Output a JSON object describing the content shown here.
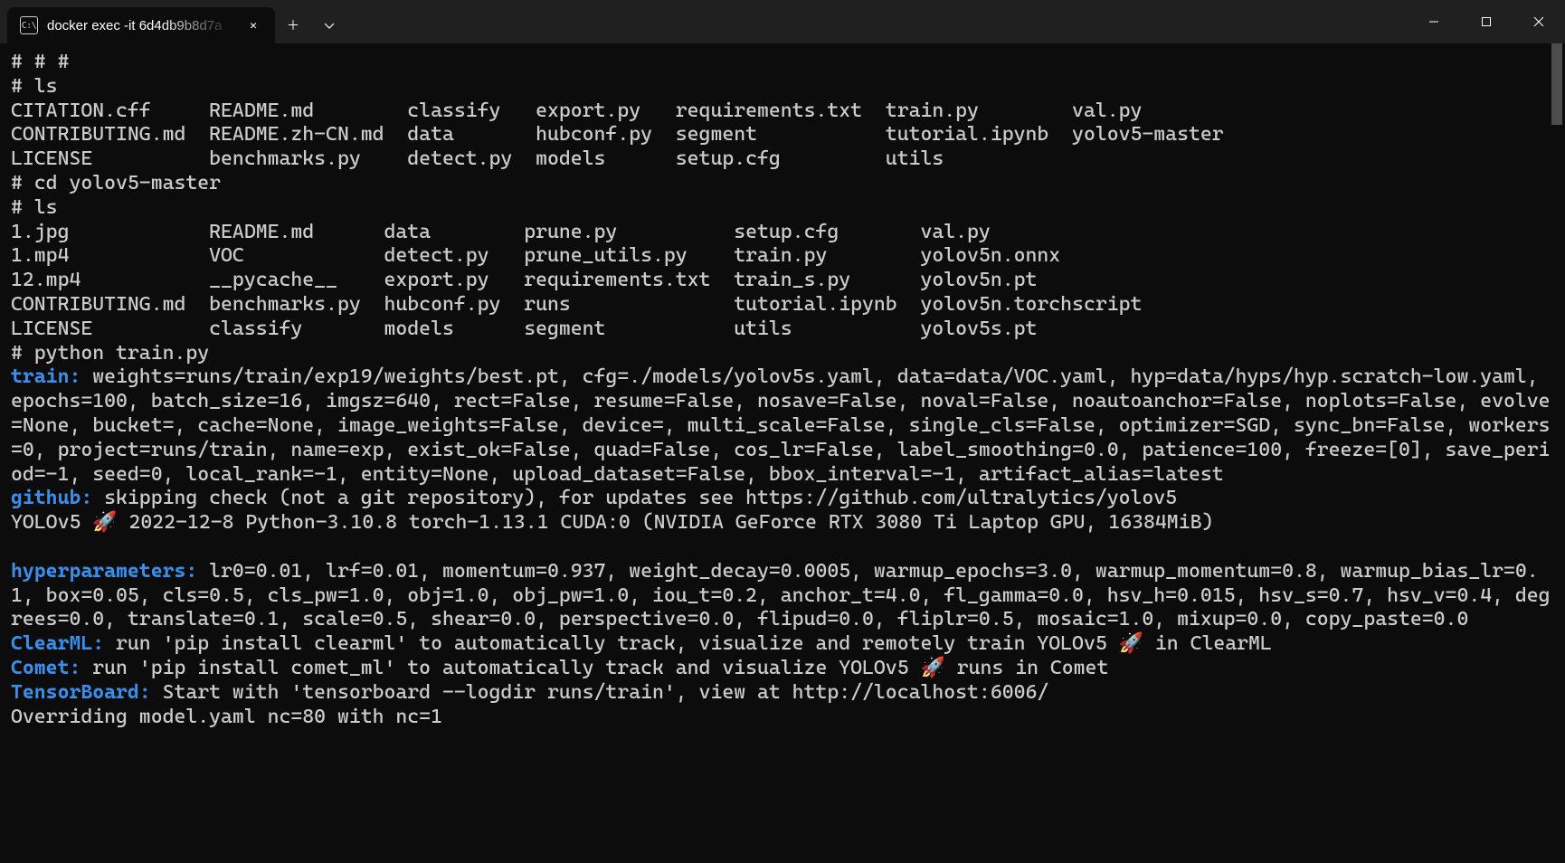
{
  "titlebar": {
    "tab_icon_text": "C:\\",
    "tab_title": "docker  exec -it 6d4db9b8d7a",
    "tab_close": "✕",
    "newtab": "＋",
    "dropdown": "⌄"
  },
  "prompt": "#",
  "cmds": {
    "ls1": "ls",
    "cd": "cd yolov5-master",
    "ls2": "ls",
    "py": "python train.py"
  },
  "header_line": "# # #",
  "ls1": {
    "r0": [
      "CITATION.cff",
      "README.md",
      "classify",
      "export.py",
      "requirements.txt",
      "train.py",
      "val.py"
    ],
    "r1": [
      "CONTRIBUTING.md",
      "README.zh-CN.md",
      "data",
      "hubconf.py",
      "segment",
      "tutorial.ipynb",
      "yolov5-master"
    ],
    "r2": [
      "LICENSE",
      "benchmarks.py",
      "detect.py",
      "models",
      "setup.cfg",
      "utils",
      ""
    ]
  },
  "ls2": {
    "r0": [
      "1.jpg",
      "README.md",
      "data",
      "prune.py",
      "setup.cfg",
      "val.py"
    ],
    "r1": [
      "1.mp4",
      "VOC",
      "detect.py",
      "prune_utils.py",
      "train.py",
      "yolov5n.onnx"
    ],
    "r2": [
      "12.mp4",
      "__pycache__",
      "export.py",
      "requirements.txt",
      "train_s.py",
      "yolov5n.pt"
    ],
    "r3": [
      "CONTRIBUTING.md",
      "benchmarks.py",
      "hubconf.py",
      "runs",
      "tutorial.ipynb",
      "yolov5n.torchscript"
    ],
    "r4": [
      "LICENSE",
      "classify",
      "models",
      "segment",
      "utils",
      "yolov5s.pt"
    ]
  },
  "train": {
    "label": "train:",
    "text": " weights=runs/train/exp19/weights/best.pt, cfg=./models/yolov5s.yaml, data=data/VOC.yaml, hyp=data/hyps/hyp.scratch-low.yaml, epochs=100, batch_size=16, imgsz=640, rect=False, resume=False, nosave=False, noval=False, noautoanchor=False, noplots=False, evolve=None, bucket=, cache=None, image_weights=False, device=, multi_scale=False, single_cls=False, optimizer=SGD, sync_bn=False, workers=0, project=runs/train, name=exp, exist_ok=False, quad=False, cos_lr=False, label_smoothing=0.0, patience=100, freeze=[0], save_period=-1, seed=0, local_rank=-1, entity=None, upload_dataset=False, bbox_interval=-1, artifact_alias=latest"
  },
  "github": {
    "label": "github:",
    "text": " skipping check (not a git repository), for updates see https://github.com/ultralytics/yolov5"
  },
  "yolo_line": "YOLOv5 🚀 2022-12-8 Python-3.10.8 torch-1.13.1 CUDA:0 (NVIDIA GeForce RTX 3080 Ti Laptop GPU, 16384MiB)",
  "hyper": {
    "label": "hyperparameters:",
    "text": " lr0=0.01, lrf=0.01, momentum=0.937, weight_decay=0.0005, warmup_epochs=3.0, warmup_momentum=0.8, warmup_bias_lr=0.1, box=0.05, cls=0.5, cls_pw=1.0, obj=1.0, obj_pw=1.0, iou_t=0.2, anchor_t=4.0, fl_gamma=0.0, hsv_h=0.015, hsv_s=0.7, hsv_v=0.4, degrees=0.0, translate=0.1, scale=0.5, shear=0.0, perspective=0.0, flipud=0.0, fliplr=0.5, mosaic=1.0, mixup=0.0, copy_paste=0.0"
  },
  "clearml": {
    "label": "ClearML:",
    "text": " run 'pip install clearml' to automatically track, visualize and remotely train YOLOv5 🚀 in ClearML"
  },
  "comet": {
    "label": "Comet:",
    "text": " run 'pip install comet_ml' to automatically track and visualize YOLOv5 🚀 runs in Comet"
  },
  "tensorboard": {
    "label": "TensorBoard:",
    "text": " Start with 'tensorboard --logdir runs/train', view at http://localhost:6006/"
  },
  "override": "Overriding model.yaml nc=80 with nc=1"
}
